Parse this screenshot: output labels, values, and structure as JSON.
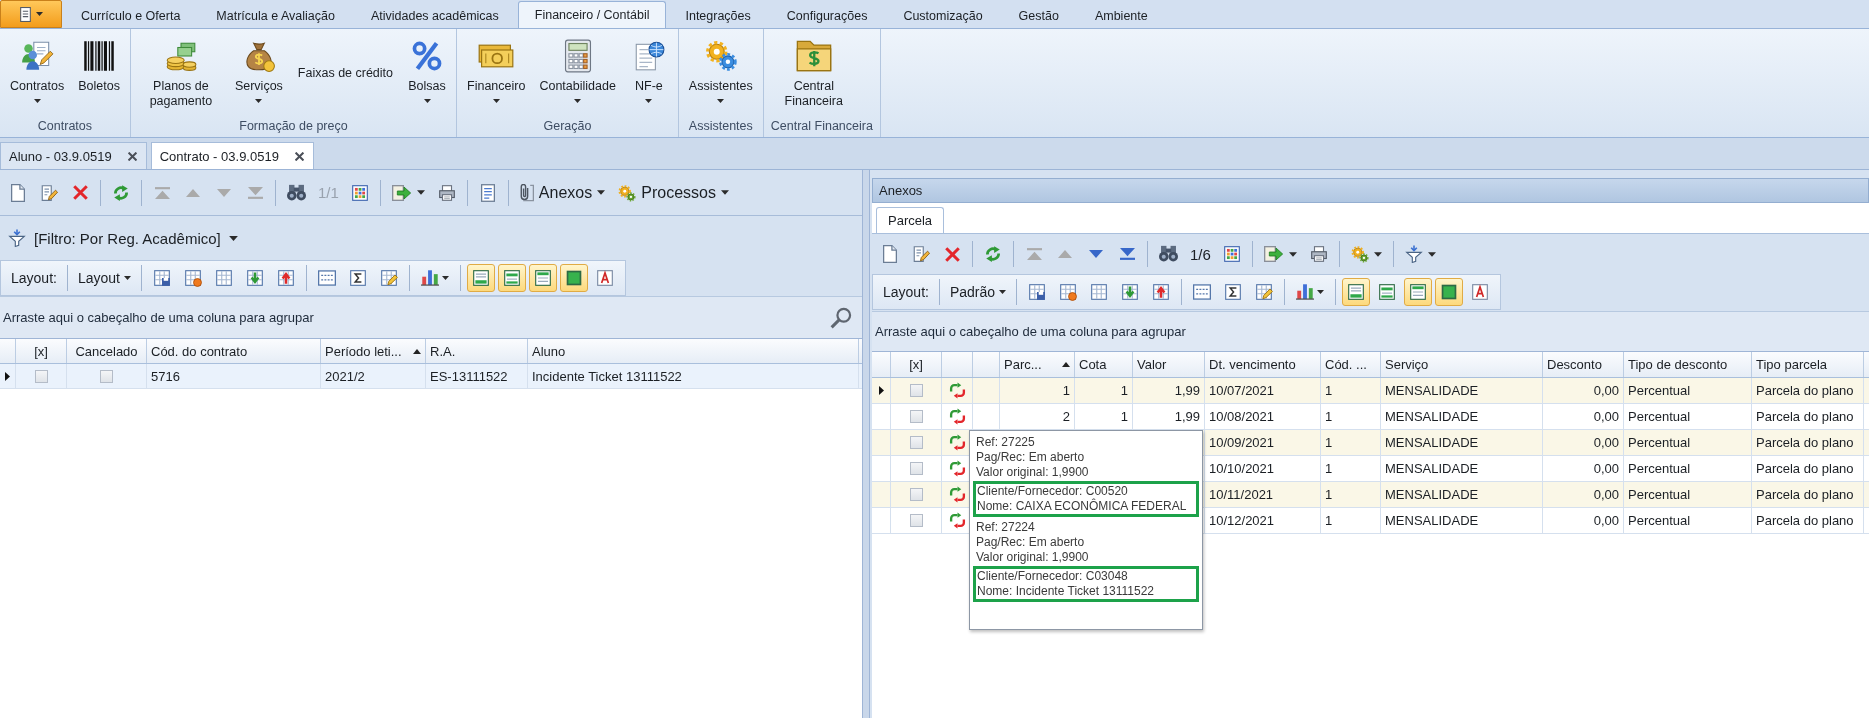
{
  "ribbon": {
    "tabs": [
      {
        "label": "Currículo e Oferta",
        "selected": false
      },
      {
        "label": "Matrícula e Avaliação",
        "selected": false
      },
      {
        "label": "Atividades acadêmicas",
        "selected": false
      },
      {
        "label": "Financeiro / Contábil",
        "selected": true
      },
      {
        "label": "Integrações",
        "selected": false
      },
      {
        "label": "Configurações",
        "selected": false
      },
      {
        "label": "Customização",
        "selected": false
      },
      {
        "label": "Gestão",
        "selected": false
      },
      {
        "label": "Ambiente",
        "selected": false
      }
    ],
    "groups": [
      {
        "label": "Contratos",
        "buttons": [
          {
            "kind": "contracts",
            "label": "Contratos",
            "dropdown": true
          },
          {
            "kind": "barcode",
            "label": "Boletos",
            "dropdown": false
          }
        ]
      },
      {
        "label": "Formação de preço",
        "buttons": [
          {
            "kind": "coins",
            "label": "Planos de pagamento",
            "dropdown": false
          },
          {
            "kind": "money-bag",
            "label": "Serviços",
            "dropdown": true
          },
          {
            "kind": "small",
            "label": "Faixas de crédito",
            "dropdown": false
          },
          {
            "kind": "percent",
            "label": "Bolsas",
            "dropdown": true
          }
        ]
      },
      {
        "label": "Geração",
        "buttons": [
          {
            "kind": "banknotes",
            "label": "Financeiro",
            "dropdown": true
          },
          {
            "kind": "calculator",
            "label": "Contabilidade",
            "dropdown": true
          },
          {
            "kind": "document-globe",
            "label": "NF-e",
            "dropdown": true
          }
        ]
      },
      {
        "label": "Assistentes",
        "buttons": [
          {
            "kind": "gears",
            "label": "Assistentes",
            "dropdown": true
          }
        ]
      },
      {
        "label": "Central Financeira",
        "buttons": [
          {
            "kind": "dollar-folder",
            "label": "Central Financeira",
            "dropdown": false
          }
        ]
      }
    ]
  },
  "document_tabs": [
    {
      "label": "Aluno - 03.9.0519",
      "selected": false
    },
    {
      "label": "Contrato - 03.9.0519",
      "selected": true
    }
  ],
  "left_panel": {
    "toolbar": [
      [
        {
          "kind": "new",
          "disabled": false,
          "dropdown": false
        },
        {
          "kind": "edit",
          "disabled": false,
          "dropdown": false
        },
        {
          "kind": "delete",
          "disabled": false,
          "dropdown": false
        }
      ],
      [
        {
          "kind": "refresh",
          "disabled": false,
          "dropdown": false
        }
      ],
      [
        {
          "kind": "first",
          "disabled": true,
          "dropdown": false
        },
        {
          "kind": "prev",
          "disabled": true,
          "dropdown": false
        },
        {
          "kind": "next",
          "disabled": true,
          "dropdown": false
        },
        {
          "kind": "last",
          "disabled": true,
          "dropdown": false
        }
      ],
      [
        {
          "kind": "find",
          "disabled": false,
          "dropdown": false
        },
        {
          "kind": "counter",
          "text": "1/1",
          "disabled": true
        },
        {
          "kind": "columns",
          "disabled": false,
          "dropdown": false
        }
      ],
      [
        {
          "kind": "export",
          "disabled": false,
          "dropdown": true
        },
        {
          "kind": "print",
          "disabled": false,
          "dropdown": false
        }
      ],
      [
        {
          "kind": "report",
          "disabled": false,
          "dropdown": false
        }
      ],
      [
        {
          "kind": "attach",
          "text": "Anexos",
          "disabled": false,
          "dropdown": true
        },
        {
          "kind": "process",
          "text": "Processos",
          "disabled": false,
          "dropdown": true
        }
      ]
    ],
    "filter": {
      "label": "[Filtro: Por Reg. Acadêmico]"
    },
    "layout_bar": {
      "label": "Layout:",
      "layout_menu": "Layout",
      "tools": [
        [
          {
            "kind": "save-layout",
            "dropdown": false
          },
          {
            "kind": "delete-layout",
            "dropdown": false
          },
          {
            "kind": "custom-columns",
            "dropdown": false
          },
          {
            "kind": "import-layout",
            "dropdown": false
          },
          {
            "kind": "export-layout",
            "dropdown": false
          }
        ],
        [
          {
            "kind": "grid-lines",
            "dropdown": false
          },
          {
            "kind": "sum",
            "dropdown": false
          },
          {
            "kind": "format",
            "dropdown": false
          }
        ],
        [
          {
            "kind": "chart",
            "dropdown": true
          }
        ]
      ],
      "view_toggles": [
        {
          "kind": "footer",
          "on": true
        },
        {
          "kind": "group-footer",
          "on": true
        },
        {
          "kind": "header",
          "on": true
        },
        {
          "kind": "preview",
          "on": true
        },
        {
          "kind": "font",
          "on": false
        }
      ]
    },
    "group_panel": {
      "hint": "Arraste aqui o cabeçalho de uma coluna para agrupar",
      "search_button": true
    },
    "grid": {
      "columns": [
        {
          "kind": "check",
          "label": "[x]",
          "sorted": false
        },
        {
          "kind": "check",
          "label": "Cancelado",
          "sorted": false
        },
        {
          "kind": "text",
          "label": "Cód. do contrato",
          "sorted": false
        },
        {
          "kind": "text",
          "label": "Período leti...",
          "sorted": true
        },
        {
          "kind": "text",
          "label": "R.A.",
          "sorted": false
        },
        {
          "kind": "text",
          "label": "Aluno",
          "sorted": false
        }
      ],
      "rows": [
        {
          "selected": true,
          "cells": [
            false,
            false,
            "5716",
            "2021/2",
            "ES-13111522",
            "Incidente Ticket 13111522"
          ]
        }
      ]
    }
  },
  "right_panel": {
    "title": "Anexos",
    "tabs": [
      {
        "label": "Parcela",
        "selected": true
      }
    ],
    "toolbar": [
      [
        {
          "kind": "new",
          "disabled": false,
          "dropdown": false
        },
        {
          "kind": "edit",
          "disabled": false,
          "dropdown": false
        },
        {
          "kind": "delete",
          "disabled": false,
          "dropdown": false
        }
      ],
      [
        {
          "kind": "refresh",
          "disabled": false,
          "dropdown": false
        }
      ],
      [
        {
          "kind": "first",
          "disabled": true,
          "dropdown": false
        },
        {
          "kind": "prev",
          "disabled": true,
          "dropdown": false
        },
        {
          "kind": "next",
          "disabled": false,
          "dropdown": false
        },
        {
          "kind": "last",
          "disabled": false,
          "dropdown": false
        }
      ],
      [
        {
          "kind": "find",
          "disabled": false,
          "dropdown": false
        },
        {
          "kind": "counter",
          "text": "1/6",
          "disabled": false
        },
        {
          "kind": "columns",
          "disabled": false,
          "dropdown": false
        }
      ],
      [
        {
          "kind": "export",
          "disabled": false,
          "dropdown": true
        },
        {
          "kind": "print",
          "disabled": false,
          "dropdown": false
        }
      ],
      [
        {
          "kind": "process",
          "disabled": false,
          "dropdown": true
        }
      ],
      [
        {
          "kind": "filter",
          "disabled": false,
          "dropdown": true
        }
      ]
    ],
    "layout_bar": {
      "label": "Layout:",
      "layout_menu": "Padrão",
      "tools": [
        [
          {
            "kind": "save-layout",
            "dropdown": false
          },
          {
            "kind": "delete-layout",
            "dropdown": false
          },
          {
            "kind": "custom-columns",
            "dropdown": false
          },
          {
            "kind": "import-layout",
            "dropdown": false
          },
          {
            "kind": "export-layout",
            "dropdown": false
          }
        ],
        [
          {
            "kind": "grid-lines",
            "dropdown": false
          },
          {
            "kind": "sum",
            "dropdown": false
          },
          {
            "kind": "format",
            "dropdown": false
          }
        ],
        [
          {
            "kind": "chart",
            "dropdown": true
          }
        ]
      ],
      "view_toggles": [
        {
          "kind": "footer",
          "on": true
        },
        {
          "kind": "group-footer",
          "on": false
        },
        {
          "kind": "header",
          "on": true
        },
        {
          "kind": "preview",
          "on": true
        },
        {
          "kind": "font",
          "on": false
        }
      ]
    },
    "group_panel": {
      "hint": "Arraste aqui o cabeçalho de uma coluna para agrupar"
    },
    "grid": {
      "columns": [
        {
          "kind": "check",
          "label": "[x]",
          "sorted": false
        },
        {
          "kind": "status"
        },
        {
          "kind": "blank"
        },
        {
          "kind": "number",
          "label": "Parc...",
          "sorted": true
        },
        {
          "kind": "number",
          "label": "Cota",
          "sorted": false
        },
        {
          "kind": "number",
          "label": "Valor",
          "sorted": false
        },
        {
          "kind": "text",
          "label": "Dt. vencimento",
          "sorted": false
        },
        {
          "kind": "text",
          "label": "Cód. ...",
          "sorted": false
        },
        {
          "kind": "text",
          "label": "Serviço",
          "sorted": false
        },
        {
          "kind": "number",
          "label": "Desconto",
          "sorted": false
        },
        {
          "kind": "text",
          "label": "Tipo de desconto",
          "sorted": false
        },
        {
          "kind": "text",
          "label": "Tipo parcela",
          "sorted": false
        }
      ],
      "rows": [
        {
          "selected": true,
          "cells": [
            false,
            null,
            null,
            "1",
            "1",
            "1,99",
            "10/07/2021",
            "1",
            "MENSALIDADE",
            "0,00",
            "Percentual",
            "Parcela do plano"
          ]
        },
        {
          "selected": false,
          "cells": [
            false,
            null,
            null,
            "2",
            "1",
            "1,99",
            "10/08/2021",
            "1",
            "MENSALIDADE",
            "0,00",
            "Percentual",
            "Parcela do plano"
          ]
        },
        {
          "selected": false,
          "cells": [
            false,
            null,
            null,
            null,
            null,
            null,
            "10/09/2021",
            "1",
            "MENSALIDADE",
            "0,00",
            "Percentual",
            "Parcela do plano"
          ]
        },
        {
          "selected": false,
          "cells": [
            false,
            null,
            null,
            null,
            null,
            null,
            "10/10/2021",
            "1",
            "MENSALIDADE",
            "0,00",
            "Percentual",
            "Parcela do plano"
          ]
        },
        {
          "selected": false,
          "cells": [
            false,
            null,
            null,
            null,
            null,
            null,
            "10/11/2021",
            "1",
            "MENSALIDADE",
            "0,00",
            "Percentual",
            "Parcela do plano"
          ]
        },
        {
          "selected": false,
          "cells": [
            false,
            null,
            null,
            null,
            null,
            null,
            "10/12/2021",
            "1",
            "MENSALIDADE",
            "0,00",
            "Percentual",
            "Parcela do plano"
          ]
        }
      ]
    },
    "tooltip": {
      "entries": [
        {
          "lines": [
            "Ref: 27225",
            "Pag/Rec: Em aberto",
            "Valor original: 1,9900"
          ],
          "highlighted": [
            "Cliente/Fornecedor: C00520",
            "Nome: CAIXA ECONÔMICA FEDERAL"
          ]
        },
        {
          "lines": [
            "Ref: 27224",
            "Pag/Rec: Em aberto",
            "Valor original: 1,9900"
          ],
          "highlighted": [
            "Cliente/Fornecedor: C03048",
            "Nome: Incidente Ticket 13111522"
          ]
        }
      ]
    }
  }
}
